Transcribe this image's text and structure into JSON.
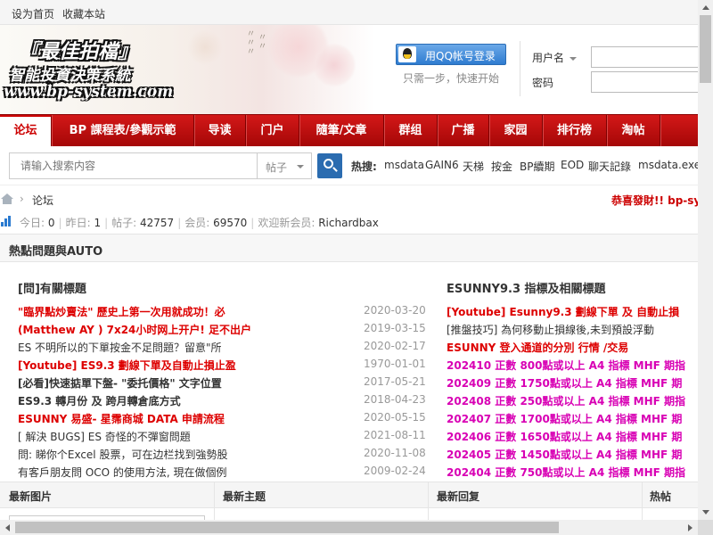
{
  "topbar": {
    "set_home": "设为首页",
    "favorite": "收藏本站"
  },
  "header": {
    "logo_title": "『最佳拍檔』",
    "logo_subtitle": "智能投資決策系統",
    "logo_url": "www.bp-system.com",
    "qq_login": "用QQ帐号登录",
    "qq_hint": "只需一步，快速开始",
    "username_label": "用户名",
    "password_label": "密码"
  },
  "nav": {
    "items": [
      {
        "label": "论坛"
      },
      {
        "label": "BP 課程表/參觀示範"
      },
      {
        "label": "导读"
      },
      {
        "label": "门户"
      },
      {
        "label": "隨筆/文章"
      },
      {
        "label": "群组"
      },
      {
        "label": "广播"
      },
      {
        "label": "家园"
      },
      {
        "label": "排行榜"
      },
      {
        "label": "淘帖"
      }
    ]
  },
  "search": {
    "placeholder": "请输入搜索内容",
    "scope": "帖子",
    "hot_label": "热搜:",
    "hot_items": [
      "msdata",
      "GAIN6",
      "天梯",
      "按金",
      "BP續期",
      "EOD",
      "聊天記錄",
      "msdata.exe"
    ]
  },
  "breadcrumb": {
    "current": "论坛",
    "marquee": "恭喜發財!! bp-sys"
  },
  "stats": {
    "today_label": "今日:",
    "today": "0",
    "yesterday_label": "昨日:",
    "yesterday": "1",
    "posts_label": "帖子:",
    "posts": "42757",
    "members_label": "会员:",
    "members": "69570",
    "newest_label": "欢迎新会员:",
    "newest": "Richardbax"
  },
  "hotbox": {
    "title": "熱點問題與AUTO",
    "left_title": "[問]有關標題",
    "right_title": "ESUNNY9.3 指標及相關標題",
    "left_threads": [
      {
        "title": "\"臨界點炒賣法\" 歷史上第一次用就成功！必",
        "date": "2020-03-20"
      },
      {
        "title": "(Matthew AY ) 7x24小时网上开户!  足不出户",
        "date": "2019-03-15"
      },
      {
        "title": "ES 不明所以的下單按金不足問題？留意\"所",
        "date": "2020-02-17"
      },
      {
        "title": "[Youtube] ES9.3 劃線下單及自動止損止盈",
        "date": "1970-01-01"
      },
      {
        "title": "[必看]快速掂單下盤- \"委托價格\" 文字位置",
        "date": "2017-05-21"
      },
      {
        "title": "ES9.3 轉月份 及 跨月轉倉底方式",
        "date": "2018-04-23"
      },
      {
        "title": "ESUNNY 易盛- 星霈商城 DATA 申請流程",
        "date": "2020-05-15"
      },
      {
        "title": "[ 解決 BUGS] ES 奇怪的不彈窗問題",
        "date": "2021-08-11"
      },
      {
        "title": "問: 睇你个Excel 股票，可在边栏找到強勢股",
        "date": "2020-11-08"
      },
      {
        "title": "有客戶朋友問 OCO 的使用方法, 現在做個例",
        "date": "2009-02-24"
      }
    ],
    "right_threads": [
      {
        "title": "[Youtube] Esunny9.3 劃線下單 及 自動止損"
      },
      {
        "title": "[推盤技巧] 為何移動止損線後,未到預設浮動"
      },
      {
        "title": "ESUNNY 登入通道的分別 行情 /交易"
      },
      {
        "title": "202410 正數 800點或以上 A4 指標 MHF 期指"
      },
      {
        "title": "202409 正數 1750點或以上 A4 指標 MHF 期"
      },
      {
        "title": "202408 正數 250點或以上 A4 指標 MHF 期指"
      },
      {
        "title": "202407 正數 1700點或以上 A4 指標 MHF 期"
      },
      {
        "title": "202406 正數 1650點或以上 A4 指標 MHF 期"
      },
      {
        "title": "202405 正數 1450點或以上 A4 指標 MHF 期"
      },
      {
        "title": "202404 正數 750點或以上 A4 指標 MHF 期指"
      }
    ]
  },
  "grid": {
    "latest_pics": "最新图片",
    "latest_topics": "最新主题",
    "latest_replies": "最新回复",
    "hot_posts": "热帖"
  },
  "colors": {
    "nav_red": "#c40c0c",
    "link_red": "#dd0000",
    "magenta": "#d800b4",
    "qq_blue": "#2f7cd0"
  },
  "icons": [
    "qq-icon",
    "search-icon",
    "home-icon",
    "stats-icon",
    "caret-down-icon"
  ]
}
